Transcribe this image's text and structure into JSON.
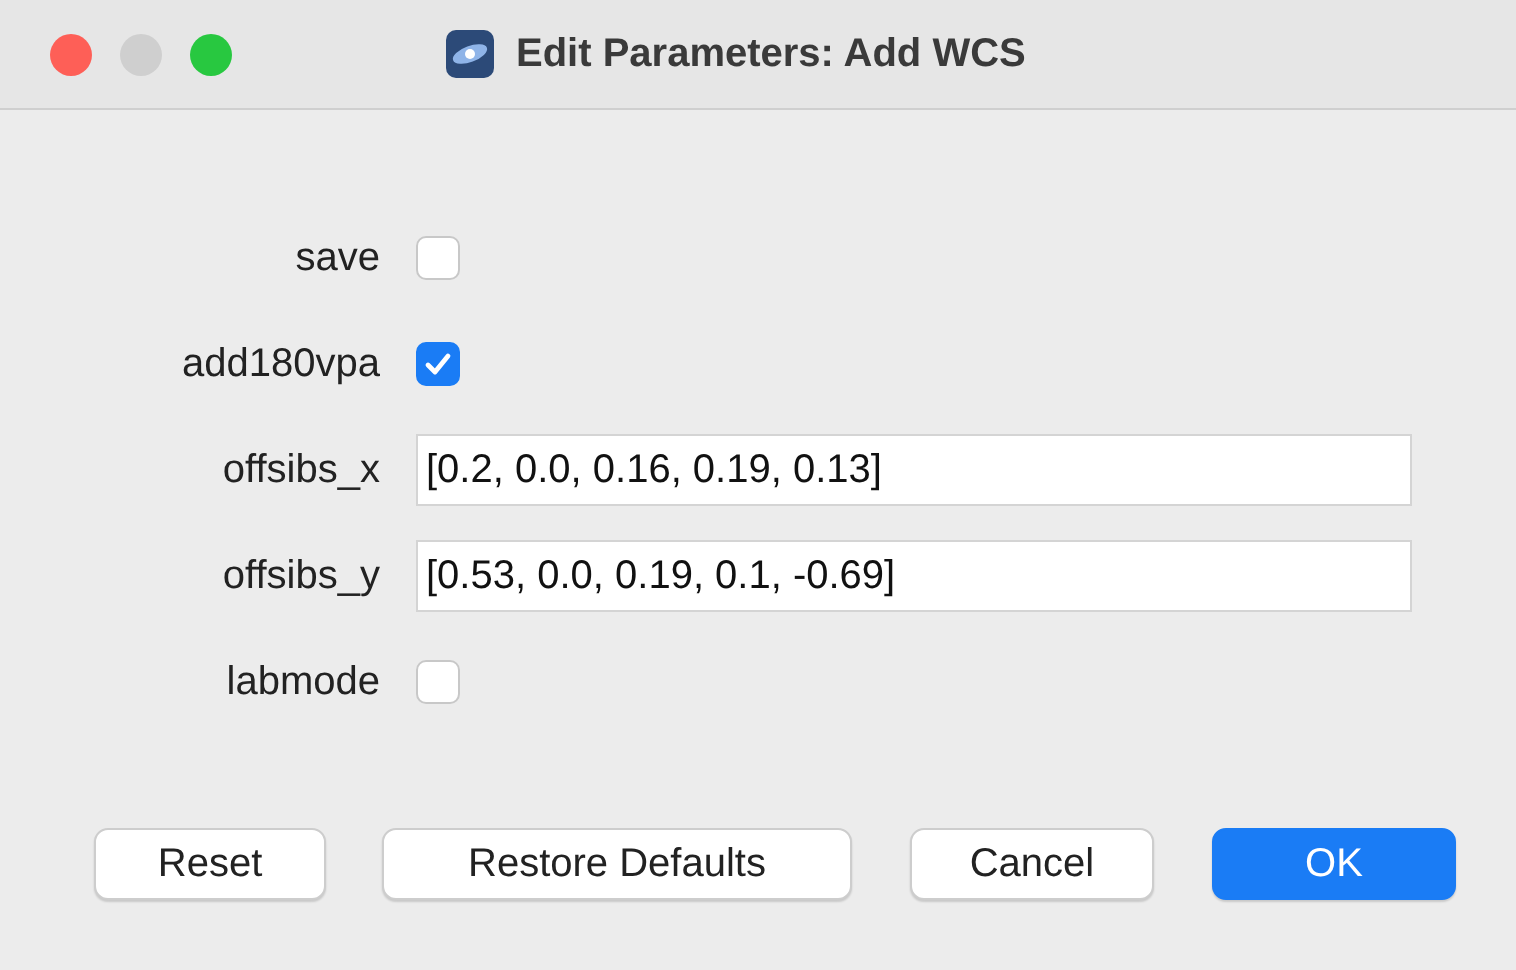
{
  "window": {
    "title": "Edit Parameters: Add WCS"
  },
  "fields": [
    {
      "kind": "checkbox",
      "label": "save",
      "checked": false
    },
    {
      "kind": "checkbox",
      "label": "add180vpa",
      "checked": true
    },
    {
      "kind": "text",
      "label": "offsibs_x",
      "value": "[0.2, 0.0, 0.16, 0.19, 0.13]"
    },
    {
      "kind": "text",
      "label": "offsibs_y",
      "value": "[0.53, 0.0, 0.19, 0.1, -0.69]"
    },
    {
      "kind": "checkbox",
      "label": "labmode",
      "checked": false
    }
  ],
  "buttons": [
    {
      "label": "Reset",
      "default": false
    },
    {
      "label": "Restore Defaults",
      "default": false
    },
    {
      "label": "Cancel",
      "default": false
    },
    {
      "label": "OK",
      "default": true
    }
  ]
}
